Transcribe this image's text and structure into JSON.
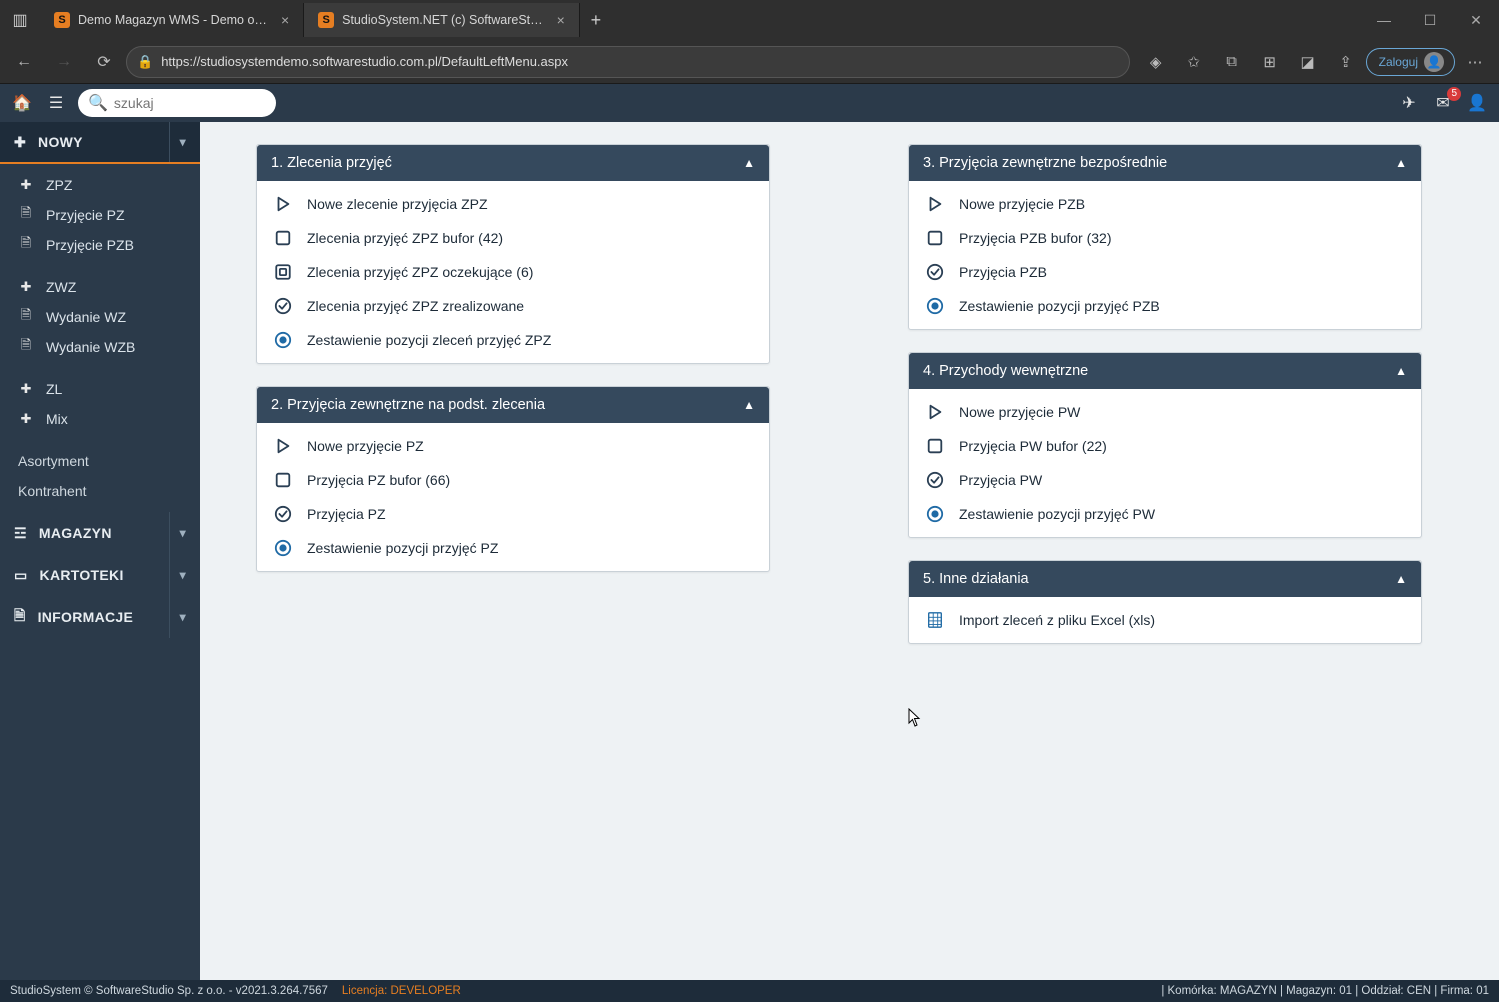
{
  "browser": {
    "tabs": [
      {
        "title": "Demo Magazyn WMS - Demo o…"
      },
      {
        "title": "StudioSystem.NET (c) SoftwareSt…"
      }
    ],
    "url": "https://studiosystemdemo.softwarestudio.com.pl/DefaultLeftMenu.aspx",
    "login_label": "Zaloguj"
  },
  "topbar": {
    "search_placeholder": "szukaj",
    "mail_badge": "5"
  },
  "sidebar": {
    "sections": {
      "nowy": "NOWY",
      "magazyn": "MAGAZYN",
      "kartoteki": "KARTOTEKI",
      "informacje": "INFORMACJE"
    },
    "group1": [
      "ZPZ",
      "Przyjęcie PZ",
      "Przyjęcie PZB"
    ],
    "group2": [
      "ZWZ",
      "Wydanie WZ",
      "Wydanie WZB"
    ],
    "group3": [
      "ZL",
      "Mix"
    ],
    "group4": [
      "Asortyment",
      "Kontrahent"
    ]
  },
  "panels": [
    {
      "title": "1. Zlecenia przyjęć",
      "items": [
        {
          "icon": "play",
          "label": "Nowe zlecenie przyjęcia ZPZ"
        },
        {
          "icon": "square",
          "label": "Zlecenia przyjęć ZPZ bufor (42)"
        },
        {
          "icon": "target",
          "label": "Zlecenia przyjęć ZPZ oczekujące (6)"
        },
        {
          "icon": "check",
          "label": "Zlecenia przyjęć ZPZ zrealizowane"
        },
        {
          "icon": "dot",
          "label": "Zestawienie pozycji zleceń przyjęć ZPZ"
        }
      ]
    },
    {
      "title": "2. Przyjęcia zewnętrzne na podst. zlecenia",
      "items": [
        {
          "icon": "play",
          "label": "Nowe przyjęcie PZ"
        },
        {
          "icon": "square",
          "label": "Przyjęcia PZ bufor (66)"
        },
        {
          "icon": "check",
          "label": "Przyjęcia PZ"
        },
        {
          "icon": "dot",
          "label": "Zestawienie pozycji przyjęć PZ"
        }
      ]
    },
    {
      "title": "3. Przyjęcia zewnętrzne bezpośrednie",
      "items": [
        {
          "icon": "play",
          "label": "Nowe przyjęcie PZB"
        },
        {
          "icon": "square",
          "label": "Przyjęcia PZB bufor (32)"
        },
        {
          "icon": "check",
          "label": "Przyjęcia PZB"
        },
        {
          "icon": "dot",
          "label": "Zestawienie pozycji przyjęć PZB"
        }
      ]
    },
    {
      "title": "4. Przychody wewnętrzne",
      "items": [
        {
          "icon": "play",
          "label": "Nowe przyjęcie PW"
        },
        {
          "icon": "square",
          "label": "Przyjęcia PW bufor (22)"
        },
        {
          "icon": "check",
          "label": "Przyjęcia PW"
        },
        {
          "icon": "dot",
          "label": "Zestawienie pozycji przyjęć PW"
        }
      ]
    },
    {
      "title": "5. Inne działania",
      "items": [
        {
          "icon": "xls",
          "label": "Import zleceń z pliku Excel (xls)"
        }
      ]
    }
  ],
  "status": {
    "left": "StudioSystem © SoftwareStudio Sp. z o.o. - v2021.3.264.7567",
    "lic_label": "Licencja:",
    "lic_value": "DEVELOPER",
    "right": "| Komórka: MAGAZYN | Magazyn: 01 | Oddział: CEN | Firma: 01"
  }
}
